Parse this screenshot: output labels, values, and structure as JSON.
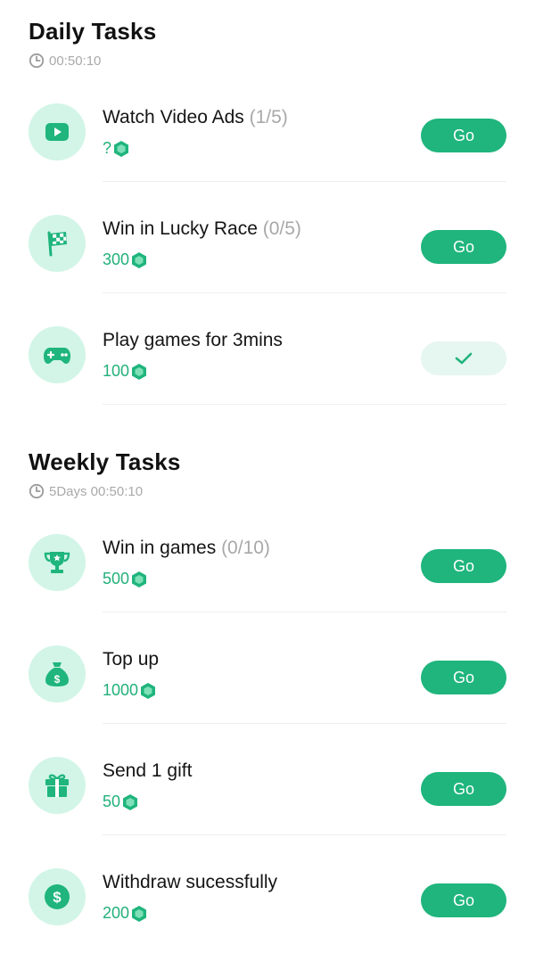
{
  "colors": {
    "accent": "#1fb57d",
    "icon_bg": "#d2f5e7",
    "muted": "#a9a9a9",
    "reward": "#22b07a"
  },
  "daily": {
    "title": "Daily Tasks",
    "timer": "00:50:10",
    "tasks": [
      {
        "icon": "video-play-icon",
        "title": "Watch Video Ads",
        "progress": "(1/5)",
        "reward": "?",
        "action": "Go"
      },
      {
        "icon": "checkered-flag-icon",
        "title": "Win in Lucky Race",
        "progress": "(0/5)",
        "reward": "300",
        "action": "Go"
      },
      {
        "icon": "gamepad-icon",
        "title": "Play games for 3mins",
        "progress": "",
        "reward": "100",
        "action": "completed"
      }
    ]
  },
  "weekly": {
    "title": "Weekly Tasks",
    "timer": "5Days 00:50:10",
    "tasks": [
      {
        "icon": "trophy-icon",
        "title": "Win in games",
        "progress": "(0/10)",
        "reward": "500",
        "action": "Go"
      },
      {
        "icon": "money-bag-icon",
        "title": "Top up",
        "progress": "",
        "reward": "1000",
        "action": "Go"
      },
      {
        "icon": "gift-icon",
        "title": "Send 1 gift",
        "progress": "",
        "reward": "50",
        "action": "Go"
      },
      {
        "icon": "dollar-coin-icon",
        "title": "Withdraw sucessfully",
        "progress": "",
        "reward": "200",
        "action": "Go"
      }
    ]
  }
}
